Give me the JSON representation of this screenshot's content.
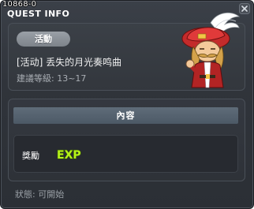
{
  "window": {
    "quest_id": "10868-0",
    "title": "QUEST INFO"
  },
  "quest": {
    "category_badge": "活動",
    "name": "[活动] 丢失的月光奏鸣曲",
    "level_range": "建議等級: 13~17",
    "npc_icon": "npc-pirate-captain-portrait"
  },
  "content": {
    "header": "內容",
    "reward_label": "獎勵",
    "reward_icon": "exp-icon",
    "reward_text": "EXP"
  },
  "status": {
    "text": "狀態: 可開始"
  },
  "colors": {
    "window_bg": "#30343b",
    "header_bar": "#56636f",
    "exp_green": "#b6f21a"
  }
}
